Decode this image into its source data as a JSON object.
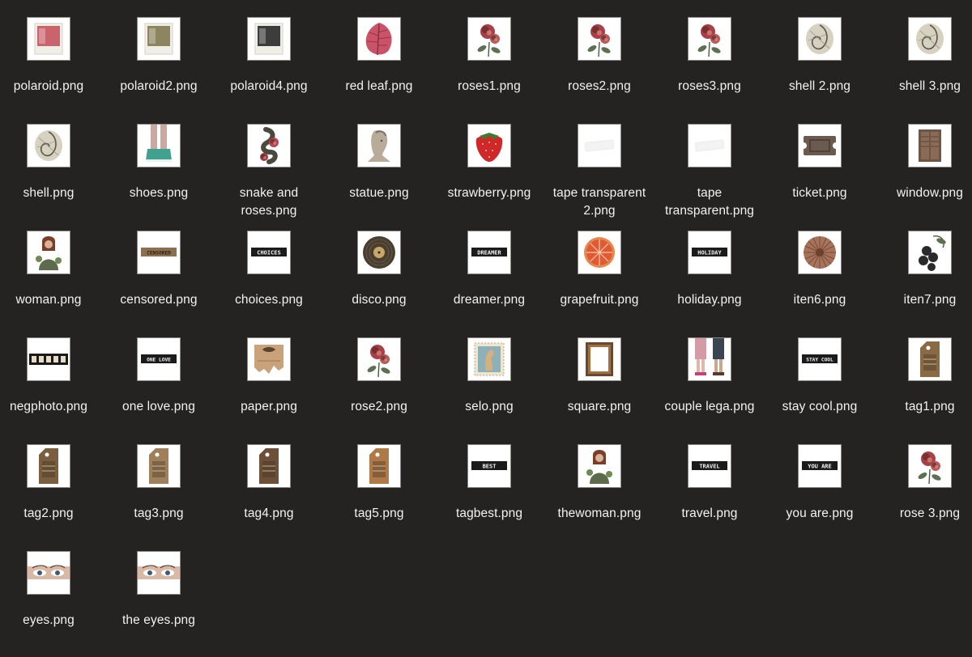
{
  "window": {
    "background": "#252321"
  },
  "files": [
    {
      "name": "polaroid.png",
      "icon": "polaroid-photo-icon"
    },
    {
      "name": "polaroid2.png",
      "icon": "polaroid-photo-icon"
    },
    {
      "name": "polaroid4.png",
      "icon": "polaroid-photo-icon"
    },
    {
      "name": "red leaf.png",
      "icon": "leaf-icon"
    },
    {
      "name": "roses1.png",
      "icon": "rose-icon"
    },
    {
      "name": "roses2.png",
      "icon": "rose-icon"
    },
    {
      "name": "roses3.png",
      "icon": "rose-icon"
    },
    {
      "name": "shell 2.png",
      "icon": "shell-icon"
    },
    {
      "name": "shell 3.png",
      "icon": "shell-icon"
    },
    {
      "name": "shell.png",
      "icon": "shell-icon"
    },
    {
      "name": "shoes.png",
      "icon": "shoes-icon"
    },
    {
      "name": "snake and\nroses.png",
      "icon": "snake-icon"
    },
    {
      "name": "statue.png",
      "icon": "statue-icon"
    },
    {
      "name": "strawberry.png",
      "icon": "strawberry-icon"
    },
    {
      "name": "tape transparent\n2.png",
      "icon": "tape-icon"
    },
    {
      "name": "tape\ntransparent.png",
      "icon": "tape-icon"
    },
    {
      "name": "ticket.png",
      "icon": "ticket-icon"
    },
    {
      "name": "window.png",
      "icon": "window-icon"
    },
    {
      "name": "woman.png",
      "icon": "woman-icon"
    },
    {
      "name": "censored.png",
      "icon": "label-icon",
      "label_text": "CENSORED"
    },
    {
      "name": "choices.png",
      "icon": "label-icon",
      "label_text": "CHOICES"
    },
    {
      "name": "disco.png",
      "icon": "vinyl-icon"
    },
    {
      "name": "dreamer.png",
      "icon": "label-icon",
      "label_text": "DREAMER"
    },
    {
      "name": "grapefruit.png",
      "icon": "grapefruit-icon"
    },
    {
      "name": "holiday.png",
      "icon": "label-icon",
      "label_text": "HOLIDAY"
    },
    {
      "name": "iten6.png",
      "icon": "rosette-icon"
    },
    {
      "name": "iten7.png",
      "icon": "berries-icon"
    },
    {
      "name": "negphoto.png",
      "icon": "film-strip-icon"
    },
    {
      "name": "one love.png",
      "icon": "label-icon",
      "label_text": "ONE LOVE"
    },
    {
      "name": "paper.png",
      "icon": "paper-icon"
    },
    {
      "name": "rose2.png",
      "icon": "rose-icon"
    },
    {
      "name": "selo.png",
      "icon": "stamp-icon"
    },
    {
      "name": "square.png",
      "icon": "frame-icon"
    },
    {
      "name": "couple lega.png",
      "icon": "legs-icon"
    },
    {
      "name": "stay cool.png",
      "icon": "label-icon",
      "label_text": "STAY COOL"
    },
    {
      "name": "tag1.png",
      "icon": "tag-icon"
    },
    {
      "name": "tag2.png",
      "icon": "tag-icon"
    },
    {
      "name": "tag3.png",
      "icon": "tag-icon"
    },
    {
      "name": "tag4.png",
      "icon": "tag-icon"
    },
    {
      "name": "tag5.png",
      "icon": "tag-icon"
    },
    {
      "name": "tagbest.png",
      "icon": "label-icon",
      "label_text": "BEST"
    },
    {
      "name": "thewoman.png",
      "icon": "woman-icon"
    },
    {
      "name": "travel.png",
      "icon": "label-icon",
      "label_text": "TRAVEL"
    },
    {
      "name": "you are.png",
      "icon": "label-icon",
      "label_text": "YOU ARE"
    },
    {
      "name": "rose 3.png",
      "icon": "rose-icon"
    },
    {
      "name": "eyes.png",
      "icon": "eyes-icon"
    },
    {
      "name": "the eyes.png",
      "icon": "eyes-icon"
    }
  ]
}
